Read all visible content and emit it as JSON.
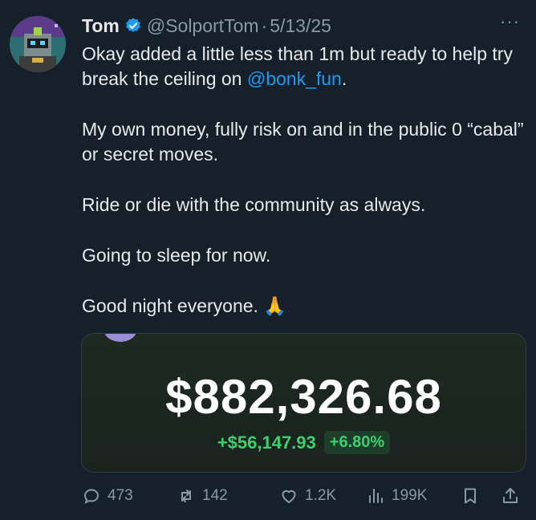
{
  "author": {
    "name": "Tom",
    "handle": "@SolportTom",
    "separator": "·",
    "date": "5/13/25",
    "more": "···"
  },
  "tweet": {
    "line1_before": "Okay added a little less than 1m but ready to help try break the ceiling on ",
    "mention": "@bonk_fun",
    "line1_after": ".",
    "paragraph2": "My own money, fully risk on and in the public 0 “cabal” or secret moves.",
    "paragraph3": "Ride or die with the community as always.",
    "paragraph4": "Going to sleep for now.",
    "paragraph5": "Good night everyone. 🙏"
  },
  "card": {
    "balance": "$882,326.68",
    "change": "+$56,147.93",
    "percent": "+6.80%"
  },
  "actions": {
    "replies": "473",
    "retweets": "142",
    "likes": "1.2K",
    "views": "199K"
  },
  "colors": {
    "background": "#15202b",
    "mention": "#1d9bf0",
    "verified": "#1d9bf0",
    "gain": "#3ecf6e"
  }
}
